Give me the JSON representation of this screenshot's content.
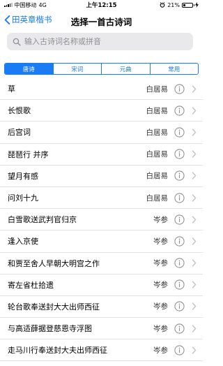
{
  "status_bar": {
    "carrier": "中国移动",
    "network": "4G",
    "time": "上午12:15",
    "battery_percent": "21%",
    "battery_level": 0.21
  },
  "nav": {
    "back_label": "田英章楷书",
    "title": "选择一首古诗词"
  },
  "search": {
    "placeholder": "输入古诗词名称或拼音"
  },
  "segments": [
    {
      "label": "唐诗",
      "active": true
    },
    {
      "label": "宋词",
      "active": false
    },
    {
      "label": "元曲",
      "active": false
    },
    {
      "label": "常用",
      "active": false
    }
  ],
  "poems": [
    {
      "title": "草",
      "author": "白居易"
    },
    {
      "title": "长恨歌",
      "author": "白居易"
    },
    {
      "title": "后宫词",
      "author": "白居易"
    },
    {
      "title": "琵琶行 并序",
      "author": "白居易"
    },
    {
      "title": "望月有感",
      "author": "白居易"
    },
    {
      "title": "问刘十九",
      "author": "白居易"
    },
    {
      "title": "白雪歌送武判官归京",
      "author": "岑参"
    },
    {
      "title": "逢入京使",
      "author": "岑参"
    },
    {
      "title": "和贾至舍人早朝大明宫之作",
      "author": "岑参"
    },
    {
      "title": "寄左省杜拾遗",
      "author": "岑参"
    },
    {
      "title": "轮台歌奉送封大大出师西征",
      "author": "岑参"
    },
    {
      "title": "与高适薛据登慈恩寺浮图",
      "author": "岑参"
    },
    {
      "title": "走马川行奉送封大夫出师西征",
      "author": "岑参"
    }
  ],
  "colors": {
    "accent": "#1a7cf5",
    "separator": "#e3e3e6",
    "search_bg": "#e9e9eb",
    "placeholder": "#8e8e93"
  }
}
